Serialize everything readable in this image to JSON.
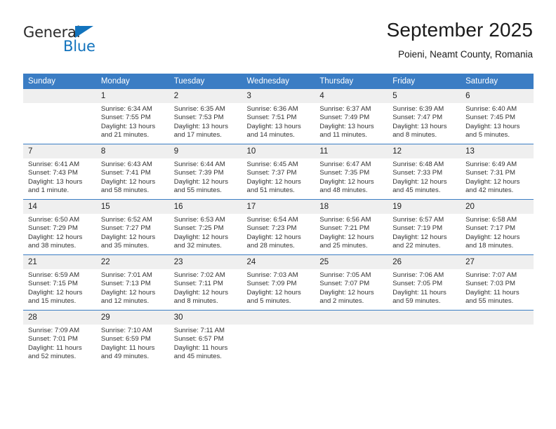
{
  "brand": {
    "name_part1": "General",
    "name_part2": "Blue",
    "triangle_icon": "triangle-icon",
    "accent_color": "#1273bd"
  },
  "header": {
    "month_title": "September 2025",
    "location": "Poieni, Neamt County, Romania"
  },
  "theme": {
    "header_blue": "#3b7dc4",
    "daynum_gray": "#efefef",
    "text_color": "#333333"
  },
  "calendar": {
    "weekday_headers": [
      "Sunday",
      "Monday",
      "Tuesday",
      "Wednesday",
      "Thursday",
      "Friday",
      "Saturday"
    ],
    "weeks": [
      [
        {
          "day": "",
          "sunrise": "",
          "sunset": "",
          "daylight1": "",
          "daylight2": ""
        },
        {
          "day": "1",
          "sunrise": "Sunrise: 6:34 AM",
          "sunset": "Sunset: 7:55 PM",
          "daylight1": "Daylight: 13 hours",
          "daylight2": "and 21 minutes."
        },
        {
          "day": "2",
          "sunrise": "Sunrise: 6:35 AM",
          "sunset": "Sunset: 7:53 PM",
          "daylight1": "Daylight: 13 hours",
          "daylight2": "and 17 minutes."
        },
        {
          "day": "3",
          "sunrise": "Sunrise: 6:36 AM",
          "sunset": "Sunset: 7:51 PM",
          "daylight1": "Daylight: 13 hours",
          "daylight2": "and 14 minutes."
        },
        {
          "day": "4",
          "sunrise": "Sunrise: 6:37 AM",
          "sunset": "Sunset: 7:49 PM",
          "daylight1": "Daylight: 13 hours",
          "daylight2": "and 11 minutes."
        },
        {
          "day": "5",
          "sunrise": "Sunrise: 6:39 AM",
          "sunset": "Sunset: 7:47 PM",
          "daylight1": "Daylight: 13 hours",
          "daylight2": "and 8 minutes."
        },
        {
          "day": "6",
          "sunrise": "Sunrise: 6:40 AM",
          "sunset": "Sunset: 7:45 PM",
          "daylight1": "Daylight: 13 hours",
          "daylight2": "and 5 minutes."
        }
      ],
      [
        {
          "day": "7",
          "sunrise": "Sunrise: 6:41 AM",
          "sunset": "Sunset: 7:43 PM",
          "daylight1": "Daylight: 13 hours",
          "daylight2": "and 1 minute."
        },
        {
          "day": "8",
          "sunrise": "Sunrise: 6:43 AM",
          "sunset": "Sunset: 7:41 PM",
          "daylight1": "Daylight: 12 hours",
          "daylight2": "and 58 minutes."
        },
        {
          "day": "9",
          "sunrise": "Sunrise: 6:44 AM",
          "sunset": "Sunset: 7:39 PM",
          "daylight1": "Daylight: 12 hours",
          "daylight2": "and 55 minutes."
        },
        {
          "day": "10",
          "sunrise": "Sunrise: 6:45 AM",
          "sunset": "Sunset: 7:37 PM",
          "daylight1": "Daylight: 12 hours",
          "daylight2": "and 51 minutes."
        },
        {
          "day": "11",
          "sunrise": "Sunrise: 6:47 AM",
          "sunset": "Sunset: 7:35 PM",
          "daylight1": "Daylight: 12 hours",
          "daylight2": "and 48 minutes."
        },
        {
          "day": "12",
          "sunrise": "Sunrise: 6:48 AM",
          "sunset": "Sunset: 7:33 PM",
          "daylight1": "Daylight: 12 hours",
          "daylight2": "and 45 minutes."
        },
        {
          "day": "13",
          "sunrise": "Sunrise: 6:49 AM",
          "sunset": "Sunset: 7:31 PM",
          "daylight1": "Daylight: 12 hours",
          "daylight2": "and 42 minutes."
        }
      ],
      [
        {
          "day": "14",
          "sunrise": "Sunrise: 6:50 AM",
          "sunset": "Sunset: 7:29 PM",
          "daylight1": "Daylight: 12 hours",
          "daylight2": "and 38 minutes."
        },
        {
          "day": "15",
          "sunrise": "Sunrise: 6:52 AM",
          "sunset": "Sunset: 7:27 PM",
          "daylight1": "Daylight: 12 hours",
          "daylight2": "and 35 minutes."
        },
        {
          "day": "16",
          "sunrise": "Sunrise: 6:53 AM",
          "sunset": "Sunset: 7:25 PM",
          "daylight1": "Daylight: 12 hours",
          "daylight2": "and 32 minutes."
        },
        {
          "day": "17",
          "sunrise": "Sunrise: 6:54 AM",
          "sunset": "Sunset: 7:23 PM",
          "daylight1": "Daylight: 12 hours",
          "daylight2": "and 28 minutes."
        },
        {
          "day": "18",
          "sunrise": "Sunrise: 6:56 AM",
          "sunset": "Sunset: 7:21 PM",
          "daylight1": "Daylight: 12 hours",
          "daylight2": "and 25 minutes."
        },
        {
          "day": "19",
          "sunrise": "Sunrise: 6:57 AM",
          "sunset": "Sunset: 7:19 PM",
          "daylight1": "Daylight: 12 hours",
          "daylight2": "and 22 minutes."
        },
        {
          "day": "20",
          "sunrise": "Sunrise: 6:58 AM",
          "sunset": "Sunset: 7:17 PM",
          "daylight1": "Daylight: 12 hours",
          "daylight2": "and 18 minutes."
        }
      ],
      [
        {
          "day": "21",
          "sunrise": "Sunrise: 6:59 AM",
          "sunset": "Sunset: 7:15 PM",
          "daylight1": "Daylight: 12 hours",
          "daylight2": "and 15 minutes."
        },
        {
          "day": "22",
          "sunrise": "Sunrise: 7:01 AM",
          "sunset": "Sunset: 7:13 PM",
          "daylight1": "Daylight: 12 hours",
          "daylight2": "and 12 minutes."
        },
        {
          "day": "23",
          "sunrise": "Sunrise: 7:02 AM",
          "sunset": "Sunset: 7:11 PM",
          "daylight1": "Daylight: 12 hours",
          "daylight2": "and 8 minutes."
        },
        {
          "day": "24",
          "sunrise": "Sunrise: 7:03 AM",
          "sunset": "Sunset: 7:09 PM",
          "daylight1": "Daylight: 12 hours",
          "daylight2": "and 5 minutes."
        },
        {
          "day": "25",
          "sunrise": "Sunrise: 7:05 AM",
          "sunset": "Sunset: 7:07 PM",
          "daylight1": "Daylight: 12 hours",
          "daylight2": "and 2 minutes."
        },
        {
          "day": "26",
          "sunrise": "Sunrise: 7:06 AM",
          "sunset": "Sunset: 7:05 PM",
          "daylight1": "Daylight: 11 hours",
          "daylight2": "and 59 minutes."
        },
        {
          "day": "27",
          "sunrise": "Sunrise: 7:07 AM",
          "sunset": "Sunset: 7:03 PM",
          "daylight1": "Daylight: 11 hours",
          "daylight2": "and 55 minutes."
        }
      ],
      [
        {
          "day": "28",
          "sunrise": "Sunrise: 7:09 AM",
          "sunset": "Sunset: 7:01 PM",
          "daylight1": "Daylight: 11 hours",
          "daylight2": "and 52 minutes."
        },
        {
          "day": "29",
          "sunrise": "Sunrise: 7:10 AM",
          "sunset": "Sunset: 6:59 PM",
          "daylight1": "Daylight: 11 hours",
          "daylight2": "and 49 minutes."
        },
        {
          "day": "30",
          "sunrise": "Sunrise: 7:11 AM",
          "sunset": "Sunset: 6:57 PM",
          "daylight1": "Daylight: 11 hours",
          "daylight2": "and 45 minutes."
        },
        {
          "day": "",
          "sunrise": "",
          "sunset": "",
          "daylight1": "",
          "daylight2": ""
        },
        {
          "day": "",
          "sunrise": "",
          "sunset": "",
          "daylight1": "",
          "daylight2": ""
        },
        {
          "day": "",
          "sunrise": "",
          "sunset": "",
          "daylight1": "",
          "daylight2": ""
        },
        {
          "day": "",
          "sunrise": "",
          "sunset": "",
          "daylight1": "",
          "daylight2": ""
        }
      ]
    ]
  }
}
